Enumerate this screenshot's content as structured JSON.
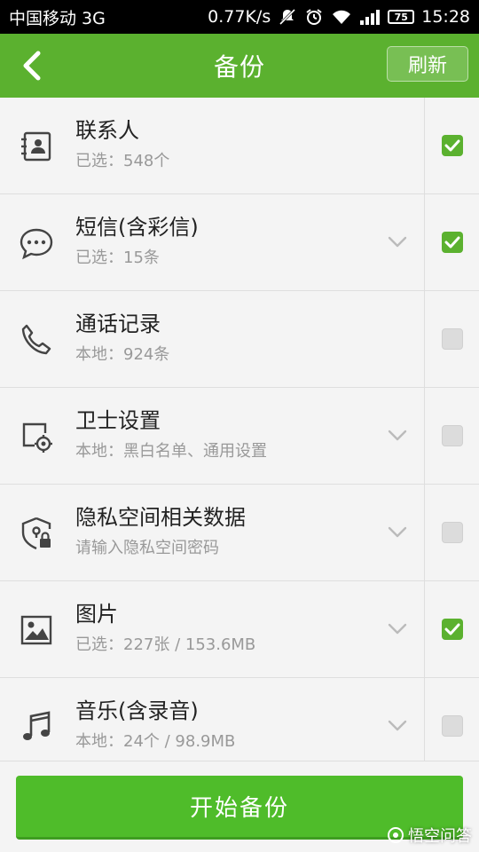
{
  "status_bar": {
    "carrier": "中国移动 3G",
    "speed": "0.77K/s",
    "battery": "75",
    "time": "15:28"
  },
  "header": {
    "title": "备份",
    "refresh_label": "刷新"
  },
  "items": [
    {
      "name": "联系人",
      "sub": "已选：548个",
      "icon": "contacts-icon",
      "expandable": false,
      "checked": true
    },
    {
      "name": "短信(含彩信)",
      "sub": "已选：15条",
      "icon": "sms-icon",
      "expandable": true,
      "checked": true
    },
    {
      "name": "通话记录",
      "sub": "本地：924条",
      "icon": "phone-icon",
      "expandable": false,
      "checked": false
    },
    {
      "name": "卫士设置",
      "sub": "本地：黑白名单、通用设置",
      "icon": "settings-icon",
      "expandable": true,
      "checked": false
    },
    {
      "name": "隐私空间相关数据",
      "sub": "请输入隐私空间密码",
      "icon": "privacy-shield-icon",
      "expandable": true,
      "checked": false
    },
    {
      "name": "图片",
      "sub": "已选：227张 / 153.6MB",
      "icon": "image-icon",
      "expandable": true,
      "checked": true
    },
    {
      "name": "音乐(含录音)",
      "sub": "本地：24个 / 98.9MB",
      "icon": "music-icon",
      "expandable": true,
      "checked": false
    }
  ],
  "footer": {
    "start_label": "开始备份"
  },
  "watermark": "悟空问答",
  "colors": {
    "accent": "#5bb12f",
    "button": "#4fbc2a"
  }
}
